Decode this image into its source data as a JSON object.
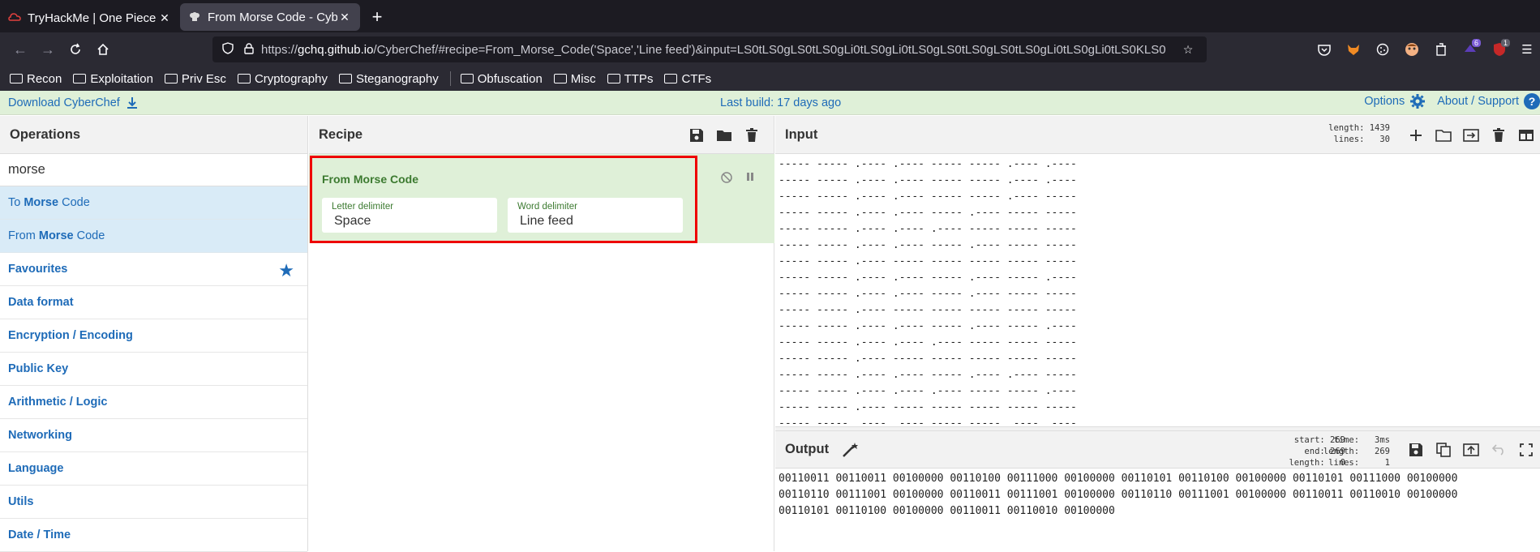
{
  "browser": {
    "tabs": [
      {
        "title": "TryHackMe | One Piece",
        "active": false
      },
      {
        "title": "From Morse Code - CyberChef",
        "active": true
      }
    ],
    "url_prefix": "https://",
    "url_domain": "gchq.github.io",
    "url_rest": "/CyberChef/#recipe=From_Morse_Code('Space','Line feed')&input=LS0tLS0gLS0tLS0gLi0tLS0gLi0tLS0gLS0tLS0gLS0tLS0gLi0tLS0gLi0tLS0KLS0",
    "extension_badges": {
      "ext1": "6",
      "ext2": "1"
    },
    "bookmarks": [
      "Recon",
      "Exploitation",
      "Priv Esc",
      "Cryptography",
      "Steganography",
      "Obfuscation",
      "Misc",
      "TTPs",
      "CTFs"
    ]
  },
  "banner": {
    "download": "Download CyberChef",
    "last_build": "Last build: 17 days ago",
    "options": "Options",
    "about": "About / Support"
  },
  "operations": {
    "title": "Operations",
    "search_value": "morse",
    "results": [
      {
        "pre": "To ",
        "match": "Morse",
        "post": " Code"
      },
      {
        "pre": "From ",
        "match": "Morse",
        "post": " Code"
      }
    ],
    "categories": [
      "Favourites",
      "Data format",
      "Encryption / Encoding",
      "Public Key",
      "Arithmetic / Logic",
      "Networking",
      "Language",
      "Utils",
      "Date / Time"
    ]
  },
  "recipe": {
    "title": "Recipe",
    "op_title": "From Morse Code",
    "letter_label": "Letter delimiter",
    "letter_value": "Space",
    "word_label": "Word delimiter",
    "word_value": "Line feed"
  },
  "input": {
    "title": "Input",
    "stats": "length: 1439\n lines:   30",
    "text": "----- ----- .---- .---- ----- ----- .---- .----\n----- ----- .---- .---- ----- ----- .---- .----\n----- ----- .---- .---- ----- ----- .---- -----\n----- ----- .---- .---- ----- .---- ----- -----\n----- ----- .---- .---- .---- ----- ----- -----\n----- ----- .---- .---- ----- .---- ----- -----\n----- ----- .---- ----- ----- ----- ----- -----\n----- ----- .---- .---- ----- .---- ----- .----\n----- ----- .---- .---- ----- .---- ----- -----\n----- ----- .---- ----- ----- ----- ----- -----\n----- ----- .---- .---- ----- .---- ----- .----\n----- ----- .---- .---- .---- ----- ----- -----\n----- ----- .---- ----- ----- ----- ----- -----\n----- ----- .---- .---- ----- .---- .---- -----\n----- ----- .---- .---- .---- ----- ----- .----\n----- ----- .---- ----- ----- ----- ----- -----\n----- ----- .---- .---- ----- ----- .---- .----\n----- ----- .---- .---- .---- ----- ----- .----"
  },
  "output": {
    "title": "Output",
    "stats_left": "start: 269\n  end: 269\nlength:   0",
    "stats_right": "  time:   3ms\nlength:   269\n lines:     1",
    "text": "00110011 00110011 00100000 00110100 00111000 00100000 00110101 00110100 00100000 00110101 00111000 00100000\n00110110 00111001 00100000 00110011 00111001 00100000 00110110 00111001 00100000 00110011 00110010 00100000\n00110101 00110100 00100000 00110011 00110010 00100000"
  },
  "colors": {
    "accent": "#1e6bb8",
    "recipe_green": "#dff0d8",
    "highlight": "#ee0000"
  }
}
